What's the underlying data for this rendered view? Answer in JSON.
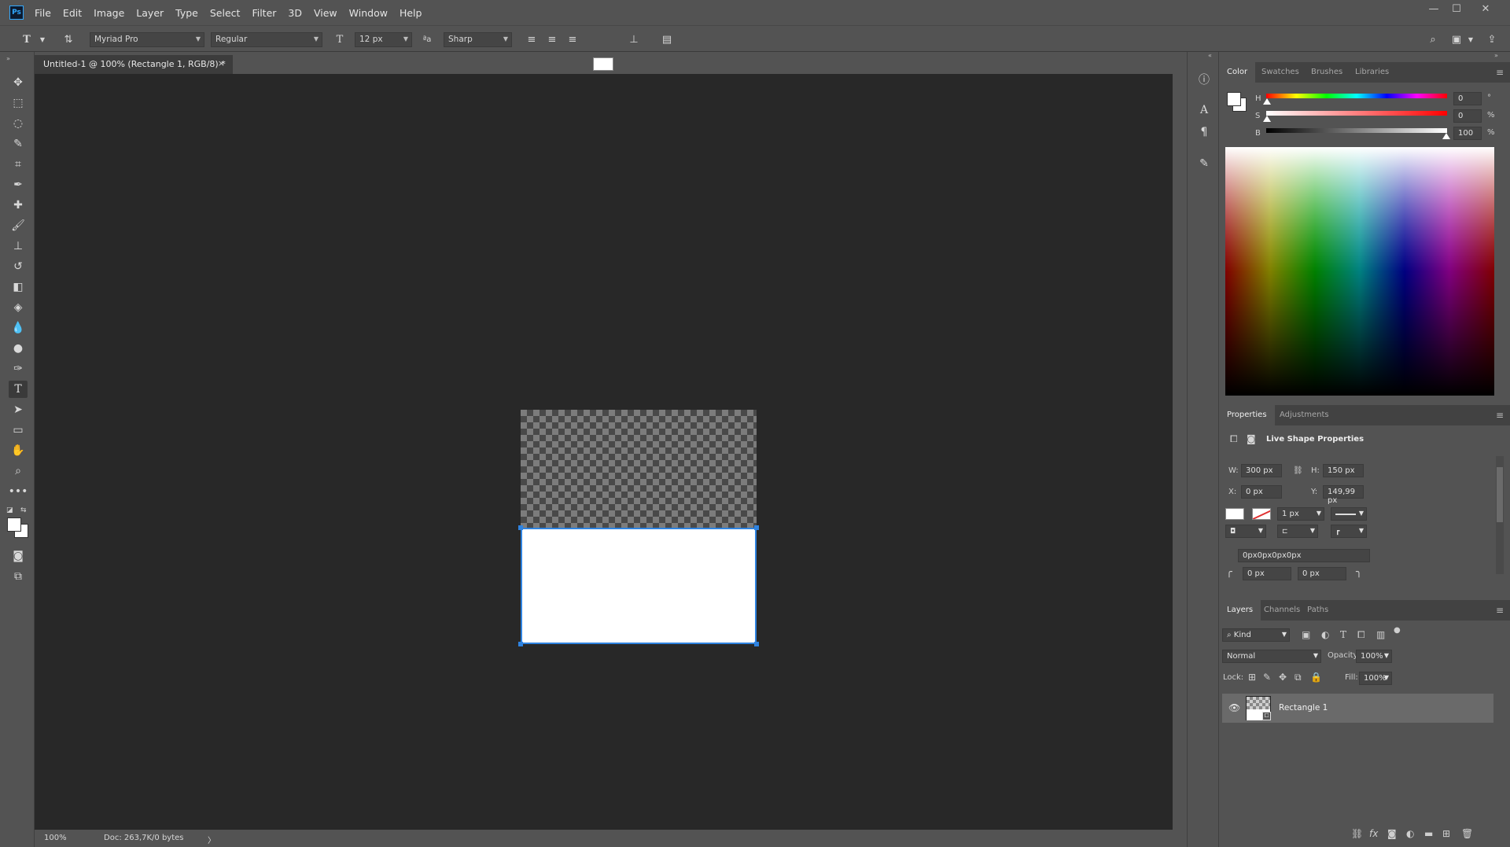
{
  "app": {
    "logo": "Ps"
  },
  "menu": [
    "File",
    "Edit",
    "Image",
    "Layer",
    "Type",
    "Select",
    "Filter",
    "3D",
    "View",
    "Window",
    "Help"
  ],
  "window_controls": {
    "minimize": "—",
    "maximize": "☐",
    "close": "✕"
  },
  "options_bar": {
    "font_family": "Myriad Pro",
    "font_style": "Regular",
    "font_size": "12 px",
    "antialias": "Sharp",
    "text_color": "#ffffff"
  },
  "document": {
    "tab_title": "Untitled-1 @ 100% (Rectangle 1, RGB/8) *",
    "close": "×",
    "zoom": "100%",
    "doc_info": "Doc: 263,7K/0 bytes",
    "status_arrow": "〉"
  },
  "color_panel": {
    "tabs": [
      "Color",
      "Swatches",
      "Brushes",
      "Libraries"
    ],
    "active_tab": "Color",
    "h": {
      "label": "H",
      "value": "0",
      "unit": "°"
    },
    "s": {
      "label": "S",
      "value": "0",
      "unit": "%"
    },
    "b": {
      "label": "B",
      "value": "100",
      "unit": "%"
    }
  },
  "properties_panel": {
    "tabs": [
      "Properties",
      "Adjustments"
    ],
    "active_tab": "Properties",
    "title": "Live Shape Properties",
    "w_label": "W:",
    "w": "300 px",
    "h_label": "H:",
    "h": "150 px",
    "x_label": "X:",
    "x": "0 px",
    "y_label": "Y:",
    "y": "149,99 px",
    "stroke_width": "1 px",
    "radius_combined": "0px0px0px0px",
    "radius_left": "0 px",
    "radius_right": "0 px"
  },
  "layers_panel": {
    "tabs": [
      "Layers",
      "Channels",
      "Paths"
    ],
    "active_tab": "Layers",
    "filter_kind": "Kind",
    "blend_mode": "Normal",
    "opacity_label": "Opacity:",
    "opacity": "100%",
    "lock_label": "Lock:",
    "fill_label": "Fill:",
    "fill": "100%",
    "layers": [
      {
        "name": "Rectangle 1",
        "visible": true
      }
    ]
  },
  "colors": {
    "accent": "#2f83e0",
    "canvas_bg": "#282828",
    "ui_bg": "#535353"
  }
}
